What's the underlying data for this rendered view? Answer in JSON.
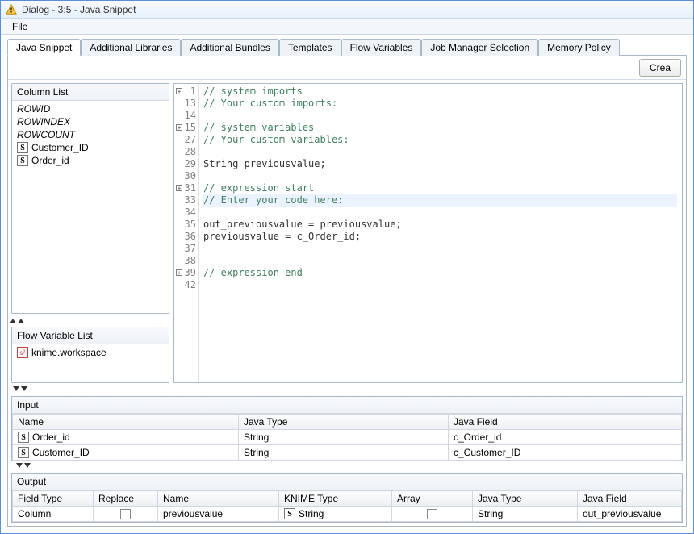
{
  "window": {
    "title": "Dialog - 3:5 - Java Snippet"
  },
  "menu": {
    "file": "File"
  },
  "tabs": [
    "Java Snippet",
    "Additional Libraries",
    "Additional Bundles",
    "Templates",
    "Flow Variables",
    "Job Manager Selection",
    "Memory Policy"
  ],
  "buttons": {
    "create": "Crea"
  },
  "column_list": {
    "title": "Column List",
    "items": [
      {
        "label": "ROWID",
        "italic": true
      },
      {
        "label": "ROWINDEX",
        "italic": true
      },
      {
        "label": "ROWCOUNT",
        "italic": true
      },
      {
        "icon": "S",
        "label": "Customer_ID"
      },
      {
        "icon": "S",
        "label": "Order_id"
      }
    ]
  },
  "flow_var_list": {
    "title": "Flow Variable List",
    "items": [
      {
        "icon": "fv",
        "label": "knime.workspace"
      }
    ]
  },
  "code": {
    "lines": [
      {
        "n": "1",
        "fold": true,
        "cls": "c",
        "text": "// system imports"
      },
      {
        "n": "13",
        "cls": "c",
        "text": "// Your custom imports:"
      },
      {
        "n": "14",
        "text": ""
      },
      {
        "n": "15",
        "fold": true,
        "cls": "c",
        "text": "// system variables"
      },
      {
        "n": "27",
        "cls": "c",
        "text": "// Your custom variables:"
      },
      {
        "n": "28",
        "text": ""
      },
      {
        "n": "29",
        "cls": "d",
        "text": "String previousvalue;"
      },
      {
        "n": "30",
        "text": ""
      },
      {
        "n": "31",
        "fold": true,
        "cls": "c",
        "text": "// expression start"
      },
      {
        "n": "33",
        "cls": "c",
        "hl": true,
        "text": "// Enter your code here:"
      },
      {
        "n": "34",
        "text": ""
      },
      {
        "n": "35",
        "cls": "d",
        "text": "out_previousvalue = previousvalue;"
      },
      {
        "n": "36",
        "cls": "d",
        "text": "previousvalue = c_Order_id;"
      },
      {
        "n": "37",
        "text": ""
      },
      {
        "n": "38",
        "text": ""
      },
      {
        "n": "39",
        "fold": true,
        "cls": "c",
        "text": "// expression end"
      },
      {
        "n": "42",
        "text": ""
      }
    ]
  },
  "input_table": {
    "title": "Input",
    "headers": [
      "Name",
      "Java Type",
      "Java Field"
    ],
    "rows": [
      {
        "icon": "S",
        "name": "Order_id",
        "javatype": "String",
        "javafield": "c_Order_id"
      },
      {
        "icon": "S",
        "name": "Customer_ID",
        "javatype": "String",
        "javafield": "c_Customer_ID"
      }
    ]
  },
  "output_table": {
    "title": "Output",
    "headers": [
      "Field Type",
      "Replace",
      "Name",
      "KNIME Type",
      "Array",
      "Java Type",
      "Java Field"
    ],
    "rows": [
      {
        "fieldtype": "Column",
        "name": "previousvalue",
        "knimetype": "String",
        "javatype": "String",
        "javafield": "out_previousvalue"
      }
    ]
  }
}
